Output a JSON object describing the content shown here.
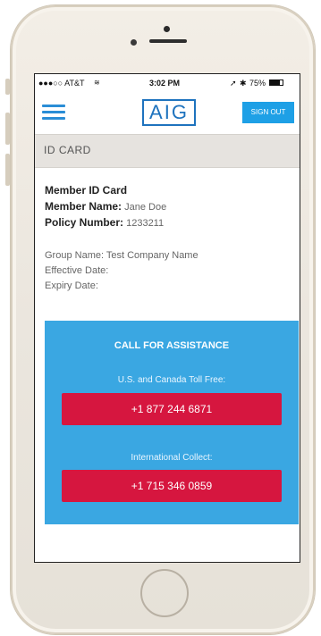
{
  "status_bar": {
    "carrier": "●●●○○ AT&T",
    "wifi": "wifi-icon",
    "time": "3:02 PM",
    "battery_text": "75%"
  },
  "header": {
    "logo": "AIG",
    "sign_out": "SIGN OUT"
  },
  "section": {
    "title": "ID CARD"
  },
  "member": {
    "title": "Member ID Card",
    "name_label": "Member Name:",
    "name_value": "Jane Doe",
    "policy_label": "Policy Number:",
    "policy_value": "1233211"
  },
  "group": {
    "name_line": "Group Name:  Test Company Name",
    "effective": "Effective Date:",
    "expiry": "Expiry Date:"
  },
  "assistance": {
    "title": "CALL FOR ASSISTANCE",
    "us_label": "U.S. and Canada Toll Free:",
    "us_number": "+1 877 244 6871",
    "intl_label": "International Collect:",
    "intl_number": "+1 715 346 0859"
  },
  "colors": {
    "accent_blue": "#3aa7e2",
    "call_red": "#d6163f",
    "logo_blue": "#1e73be"
  }
}
